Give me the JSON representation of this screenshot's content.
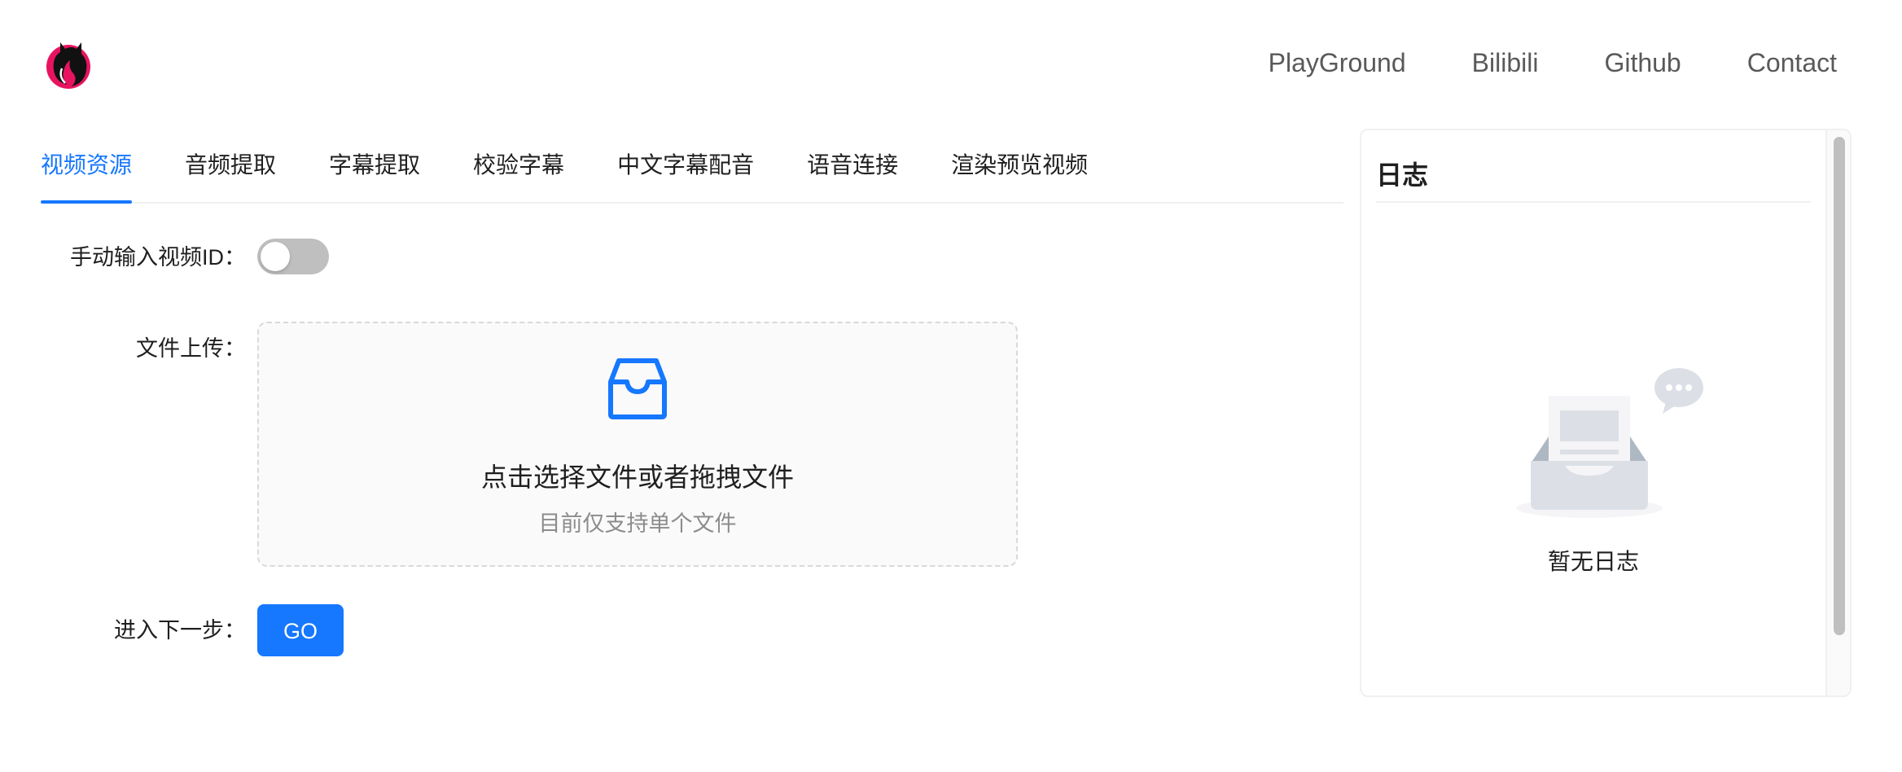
{
  "header": {
    "logo_icon": "cat-logo-icon",
    "nav": [
      {
        "label": "PlayGround"
      },
      {
        "label": "Bilibili"
      },
      {
        "label": "Github"
      },
      {
        "label": "Contact"
      }
    ]
  },
  "tabs": [
    {
      "label": "视频资源",
      "active": true
    },
    {
      "label": "音频提取"
    },
    {
      "label": "字幕提取"
    },
    {
      "label": "校验字幕"
    },
    {
      "label": "中文字幕配音"
    },
    {
      "label": "语音连接"
    },
    {
      "label": "渲染预览视频"
    }
  ],
  "form": {
    "manual_id_label": "手动输入视频ID：",
    "manual_id_enabled": false,
    "upload_label": "文件上传：",
    "upload_title": "点击选择文件或者拖拽文件",
    "upload_hint": "目前仅支持单个文件",
    "next_label": "进入下一步：",
    "go_button": "GO"
  },
  "log": {
    "title": "日志",
    "empty_text": "暂无日志"
  },
  "colors": {
    "accent": "#1677ff",
    "switch_off": "#bfbfbf",
    "border": "#f0f0f0"
  }
}
